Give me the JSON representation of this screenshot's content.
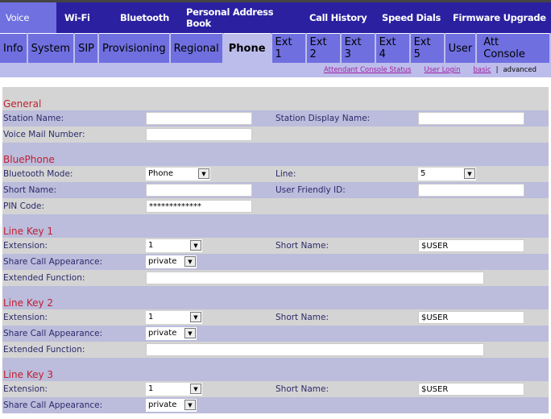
{
  "main_tabs": [
    "Voice",
    "Wi-Fi",
    "Bluetooth",
    "Personal Address Book",
    "Call History",
    "Speed Dials",
    "Firmware Upgrade"
  ],
  "sub_tabs": [
    "Info",
    "System",
    "SIP",
    "Provisioning",
    "Regional",
    "Phone",
    "Ext 1",
    "Ext 2",
    "Ext 3",
    "Ext 4",
    "Ext 5",
    "User",
    "Att Console"
  ],
  "links": {
    "att_status": "Attendant Console Status",
    "user_login": "User Login",
    "basic": "basic",
    "sep": "|",
    "advanced": "advanced"
  },
  "general": {
    "title": "General",
    "station_name": "Station Name:",
    "station_display_name": "Station Display Name:",
    "voice_mail": "Voice Mail Number:"
  },
  "bluephone": {
    "title": "BluePhone",
    "bt_mode": "Bluetooth Mode:",
    "bt_mode_value": "Phone",
    "line": "Line:",
    "line_value": "5",
    "short_name": "Short Name:",
    "user_friendly_id": "User Friendly ID:",
    "pin": "PIN Code:",
    "pin_value": "*************"
  },
  "line_keys": [
    {
      "title": "Line Key 1",
      "extension": "Extension:",
      "extension_value": "1",
      "short_name": "Short Name:",
      "short_name_value": "$USER",
      "share": "Share Call Appearance:",
      "share_value": "private",
      "extended": "Extended Function:"
    },
    {
      "title": "Line Key 2",
      "extension": "Extension:",
      "extension_value": "1",
      "short_name": "Short Name:",
      "short_name_value": "$USER",
      "share": "Share Call Appearance:",
      "share_value": "private",
      "extended": "Extended Function:"
    },
    {
      "title": "Line Key 3",
      "extension": "Extension:",
      "extension_value": "1",
      "short_name": "Short Name:",
      "short_name_value": "$USER",
      "share": "Share Call Appearance:",
      "share_value": "private"
    }
  ]
}
